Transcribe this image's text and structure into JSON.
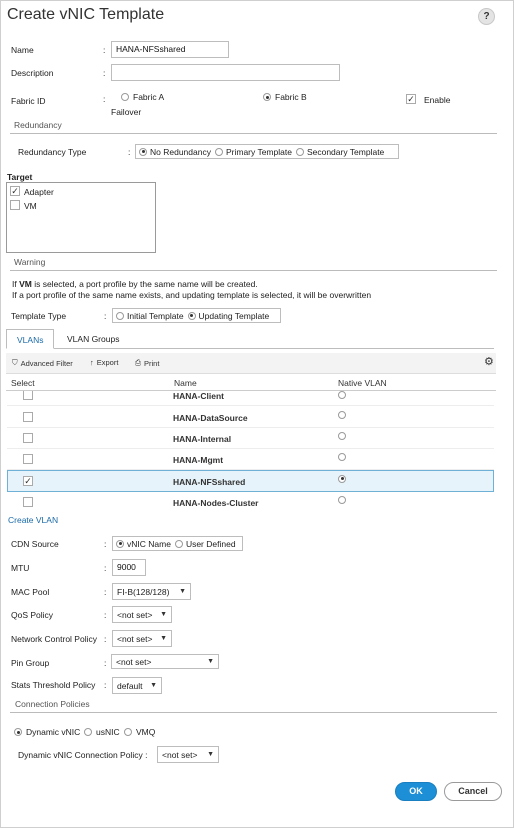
{
  "dialog": {
    "title": "Create vNIC Template",
    "help": "?"
  },
  "form": {
    "name_label": "Name",
    "name_value": "HANA-NFSshared",
    "description_label": "Description",
    "description_value": "",
    "fabric_label": "Fabric ID",
    "fabric_a": "Fabric A",
    "fabric_b": "Fabric B",
    "enable_label": "Enable",
    "failover_label": "Failover",
    "colon": ":"
  },
  "redundancy": {
    "section": "Redundancy",
    "type_label": "Redundancy Type",
    "options": [
      "No Redundancy",
      "Primary Template",
      "Secondary Template"
    ]
  },
  "target": {
    "section": "Target",
    "items": [
      "Adapter",
      "VM"
    ]
  },
  "warning": {
    "section": "Warning",
    "line1_pre": "If ",
    "line1_bold": "VM",
    "line1_post": " is selected, a port profile by the same name will be created.",
    "line2": "If a port profile of the same name exists, and updating template is selected, it will be overwritten"
  },
  "template_type": {
    "label": "Template Type",
    "options": [
      "Initial Template",
      "Updating Template"
    ]
  },
  "tabs": [
    "VLANs",
    "VLAN Groups"
  ],
  "toolbar": {
    "filter": "Advanced Filter",
    "export": "Export",
    "print": "Print"
  },
  "vlan_table": {
    "headers": [
      "Select",
      "Name",
      "Native VLAN"
    ],
    "rows": [
      {
        "name": "HANA-Client",
        "checked": false
      },
      {
        "name": "HANA-DataSource",
        "checked": false
      },
      {
        "name": "HANA-Internal",
        "checked": false
      },
      {
        "name": "HANA-Mgmt",
        "checked": false
      },
      {
        "name": "HANA-NFSshared",
        "checked": true
      },
      {
        "name": "HANA-Nodes-Cluster",
        "checked": false
      }
    ]
  },
  "create_vlan": "Create VLAN",
  "cdn": {
    "label": "CDN Source",
    "options": [
      "vNIC Name",
      "User Defined"
    ]
  },
  "mtu": {
    "label": "MTU",
    "value": "9000"
  },
  "mac_pool": {
    "label": "MAC Pool",
    "value": "FI-B(128/128)"
  },
  "qos": {
    "label": "QoS Policy",
    "value": "<not set>"
  },
  "ncp": {
    "label": "Network Control Policy",
    "value": "<not set>"
  },
  "pin": {
    "label": "Pin Group",
    "value": "<not set>"
  },
  "stats": {
    "label": "Stats Threshold Policy",
    "value": "default"
  },
  "conn": {
    "section": "Connection Policies",
    "options": [
      "Dynamic vNIC",
      "usNIC",
      "VMQ"
    ],
    "dyn_label": "Dynamic vNIC Connection Policy :",
    "dyn_value": "<not set>"
  },
  "buttons": {
    "ok": "OK",
    "cancel": "Cancel"
  }
}
